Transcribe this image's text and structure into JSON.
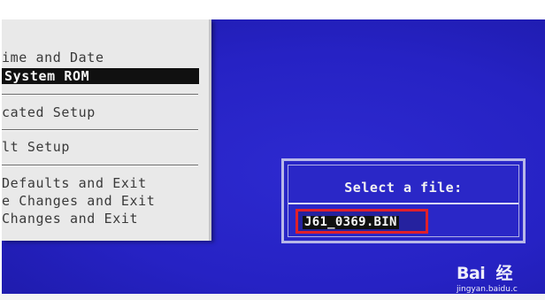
{
  "bios_menu": {
    "items": [
      {
        "label": "ime and Date",
        "selected": false
      },
      {
        "label": "System ROM",
        "selected": true
      },
      {
        "label": "cated Setup",
        "selected": false
      },
      {
        "label": "lt Setup",
        "selected": false
      },
      {
        "label": " Defaults and Exit",
        "selected": false
      },
      {
        "label": "e Changes and Exit",
        "selected": false
      },
      {
        "label": "Changes and Exit",
        "selected": false
      }
    ]
  },
  "dialog": {
    "title": "Select a file:",
    "file_value": "J61_0369.BIN"
  },
  "watermark": {
    "brand": "Bai  经",
    "url": "jingyan.baidu.c"
  },
  "colors": {
    "screen_blue": "#2622c4",
    "highlight_red": "#e0202a",
    "menu_bg": "#e9e9e9"
  }
}
